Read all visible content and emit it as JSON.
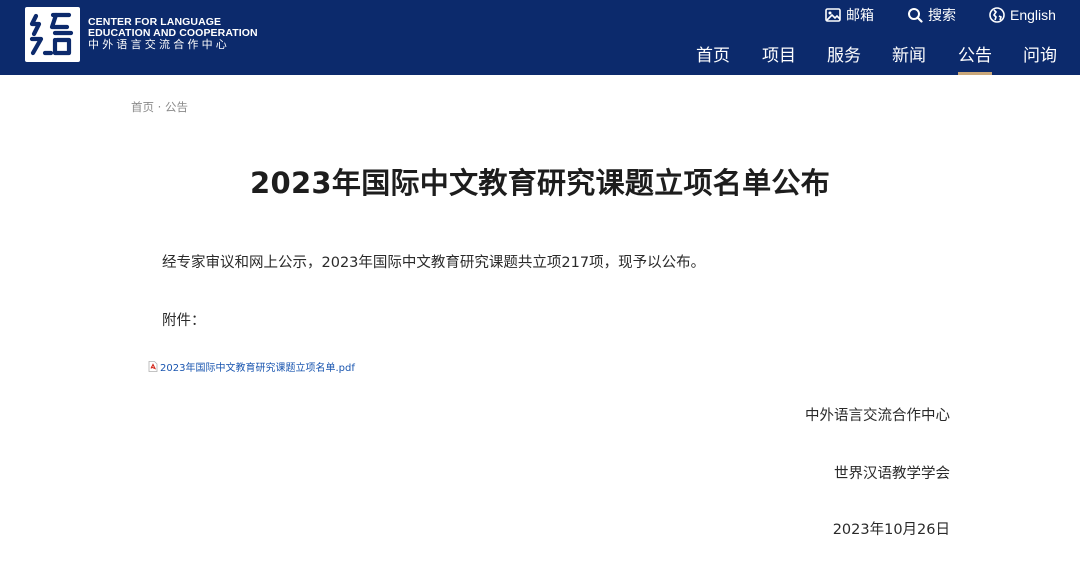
{
  "header": {
    "logo_en_line1": "CENTER FOR LANGUAGE",
    "logo_en_line2": "EDUCATION AND COOPERATION",
    "logo_zh": "中外语言交流合作中心",
    "utility": {
      "mail": "邮箱",
      "search": "搜索",
      "english": "English"
    },
    "nav": [
      "首页",
      "项目",
      "服务",
      "新闻",
      "公告",
      "问询"
    ],
    "active_nav": "公告",
    "background_color": "#0c2a6c",
    "accent_color": "#c9a77a"
  },
  "breadcrumb": "首页 · 公告",
  "article": {
    "title": "2023年国际中文教育研究课题立项名单公布",
    "paragraph": "经专家审议和网上公示，2023年国际中文教育研究课题共立项217项，现予以公布。",
    "attachment_label": "附件：",
    "attachment_file": "2023年国际中文教育研究课题立项名单.pdf",
    "signatures": [
      "中外语言交流合作中心",
      "世界汉语教学学会",
      "2023年10月26日"
    ]
  },
  "icons": {
    "mail": "mail-image-icon",
    "search": "search-icon",
    "english": "globe-icon",
    "pdf": "pdf-file-icon"
  },
  "link_color": "#1a56b0"
}
